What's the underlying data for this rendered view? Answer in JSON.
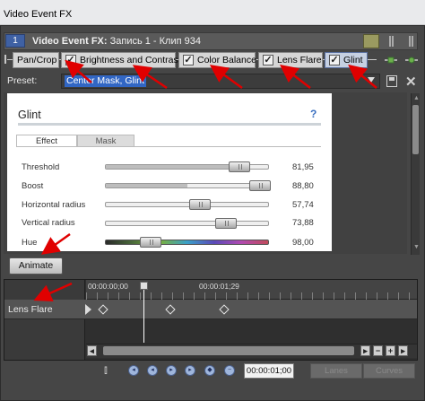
{
  "window": {
    "title": "Video Event FX"
  },
  "header": {
    "track_number": "1",
    "label_prefix": "Video Event FX:",
    "label_value": "Запись 1 - Клип 934"
  },
  "fx_chain": [
    {
      "label": "Pan/Crop",
      "checked": false,
      "active": false
    },
    {
      "label": "Brightness and Contrast",
      "checked": true,
      "active": false
    },
    {
      "label": "Color Balance",
      "checked": true,
      "active": false
    },
    {
      "label": "Lens Flare",
      "checked": true,
      "active": false
    },
    {
      "label": "Glint",
      "checked": true,
      "active": true
    }
  ],
  "preset": {
    "label": "Preset:",
    "value": "Center Mask, Glint"
  },
  "plugin": {
    "title": "Glint",
    "help": "?",
    "tabs": [
      {
        "label": "Effect",
        "active": true
      },
      {
        "label": "Mask",
        "active": false
      }
    ],
    "params": [
      {
        "name": "Threshold",
        "value": "81,95",
        "position": 0.82
      },
      {
        "name": "Boost",
        "value": "88,80",
        "position": 0.95
      },
      {
        "name": "Horizontal radius",
        "value": "57,74",
        "position": 0.58
      },
      {
        "name": "Vertical radius",
        "value": "73,88",
        "position": 0.74
      },
      {
        "name": "Hue",
        "value": "98,00",
        "position": 0.27
      }
    ]
  },
  "animate": {
    "label": "Animate"
  },
  "timeline": {
    "timecodes": [
      "00:00:00;00",
      "00:00:01;29"
    ],
    "track": {
      "name": "Lens Flare"
    },
    "keyframes": 3
  },
  "transport": {
    "timecode": "00:00:01;00",
    "lanes": "Lanes",
    "curves": "Curves"
  },
  "colors": {
    "accent": "#3166c4",
    "annotation_arrow": "#e00000",
    "panel": "#464646"
  }
}
